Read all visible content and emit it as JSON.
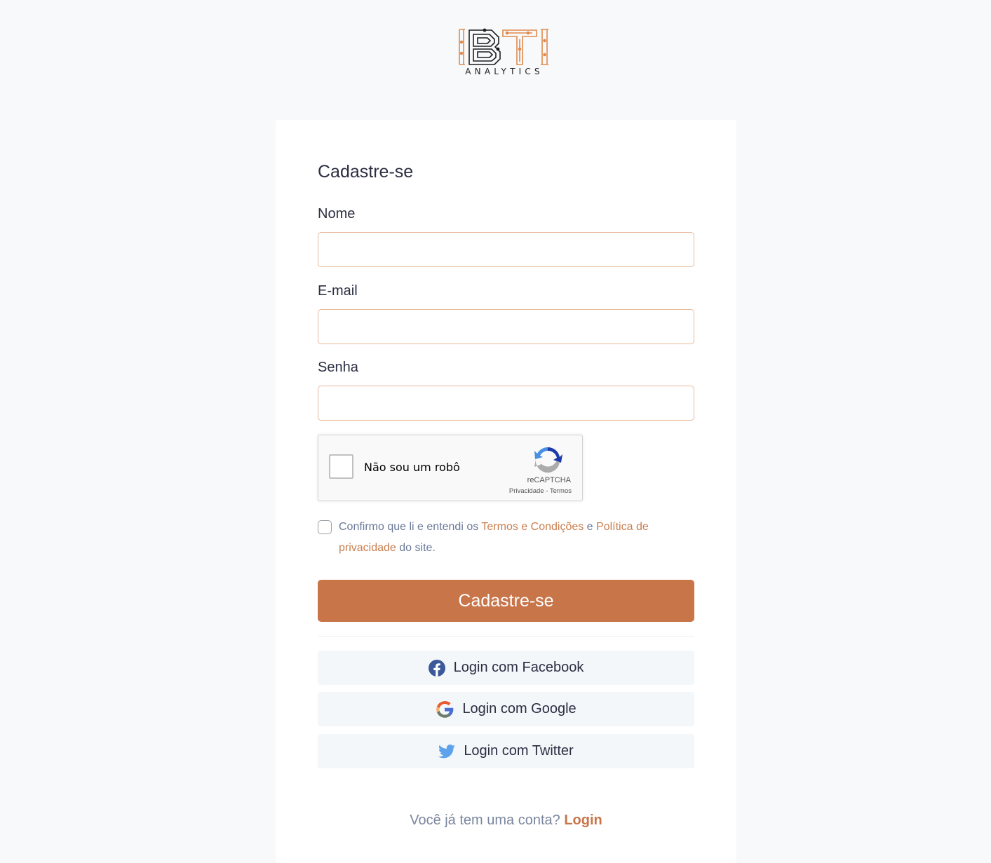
{
  "brand": {
    "logo_letters": "BTI",
    "logo_subtitle": "ANALYTICS",
    "accent_color": "#c8754a"
  },
  "form": {
    "title": "Cadastre-se",
    "fields": [
      {
        "label": "Nome",
        "value": "",
        "placeholder": ""
      },
      {
        "label": "E-mail",
        "value": "",
        "placeholder": ""
      },
      {
        "label": "Senha",
        "value": "",
        "placeholder": ""
      }
    ],
    "recaptcha": {
      "label": "Não sou um robô",
      "brand": "reCAPTCHA",
      "privacy": "Privacidade",
      "separator": "-",
      "terms": "Termos",
      "checked": false
    },
    "terms": {
      "checked": false,
      "text_1": "Confirmo que li e entendi os ",
      "link_terms": "Termos e Condições",
      "text_2": " e ",
      "link_privacy": "Política de privacidade",
      "text_3": " do site."
    },
    "submit_label": "Cadastre-se"
  },
  "social": [
    {
      "label": "Login com Facebook",
      "icon": "facebook-icon"
    },
    {
      "label": "Login com Google",
      "icon": "google-icon"
    },
    {
      "label": "Login com Twitter",
      "icon": "twitter-icon"
    }
  ],
  "footer": {
    "prompt": "Você já tem uma conta? ",
    "login_link": "Login"
  }
}
